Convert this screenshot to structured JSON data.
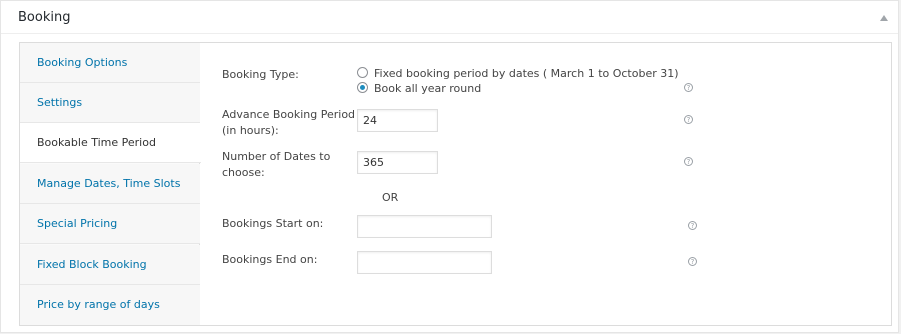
{
  "metabox": {
    "title": "Booking"
  },
  "tabs": [
    {
      "label": "Booking Options",
      "active": false
    },
    {
      "label": "Settings",
      "active": false
    },
    {
      "label": "Bookable Time Period",
      "active": true
    },
    {
      "label": "Manage Dates, Time Slots",
      "active": false
    },
    {
      "label": "Special Pricing",
      "active": false
    },
    {
      "label": "Fixed Block Booking",
      "active": false
    },
    {
      "label": "Price by range of days",
      "active": false
    }
  ],
  "form": {
    "booking_type": {
      "label": "Booking Type:",
      "options": [
        {
          "label": "Fixed booking period by dates ( March 1 to October 31)",
          "checked": false
        },
        {
          "label": "Book all year round",
          "checked": true
        }
      ]
    },
    "advance_booking": {
      "label_line1": "Advance Booking Period",
      "label_line2": "(in hours):",
      "value": "24"
    },
    "number_of_dates": {
      "label_line1": "Number of Dates to",
      "label_line2": "choose:",
      "value": "365"
    },
    "or_text": "OR",
    "bookings_start": {
      "label": "Bookings Start on:",
      "value": ""
    },
    "bookings_end": {
      "label": "Bookings End on:",
      "value": ""
    },
    "help_glyph": "?"
  },
  "colors": {
    "link": "#0073aa",
    "radio_checked": "#1e8cbe",
    "border": "#dcdcdc"
  },
  "icons": {
    "toggle": "triangle-up-icon",
    "help": "question-circle-icon"
  }
}
